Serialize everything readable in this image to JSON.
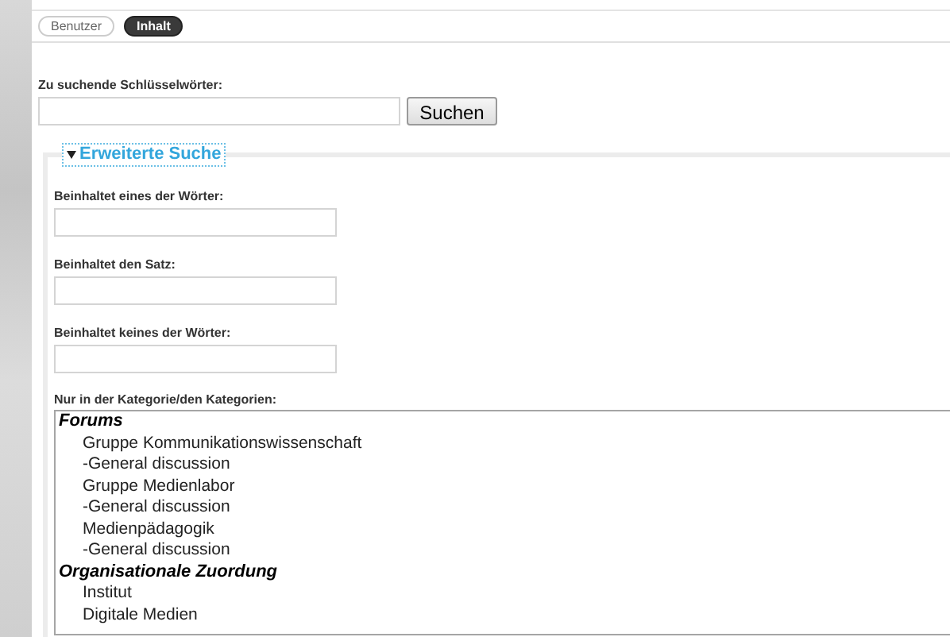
{
  "tabs": [
    {
      "label": "Benutzer",
      "selected": false
    },
    {
      "label": "Inhalt",
      "selected": true
    }
  ],
  "keywords": {
    "label": "Zu suchende Schlüsselwörter:",
    "button": "Suchen"
  },
  "advanced": {
    "legend": "Erweiterte Suche",
    "expanded": true,
    "fields": [
      {
        "label": "Beinhaltet eines der Wörter:"
      },
      {
        "label": "Beinhaltet den Satz:"
      },
      {
        "label": "Beinhaltet keines der Wörter:"
      }
    ],
    "categories": {
      "label": "Nur in der Kategorie/den Kategorien:",
      "groups": [
        {
          "label": "Forums",
          "options": [
            "Gruppe Kommunikationswissenschaft",
            "-General discussion",
            "Gruppe Medienlabor",
            "-General discussion",
            "Medienpädagogik",
            "-General discussion"
          ]
        },
        {
          "label": "Organisationale Zuordung",
          "options": [
            "Institut",
            "Digitale Medien"
          ]
        }
      ]
    }
  }
}
